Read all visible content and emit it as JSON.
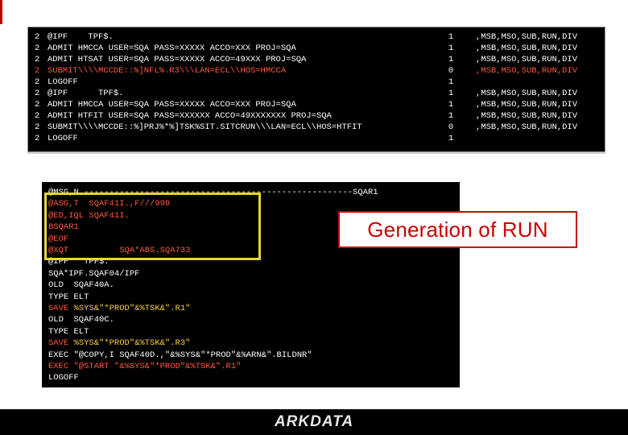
{
  "screen1": {
    "rows": [
      {
        "n": "2",
        "cmd": "@IPF    TPF$.",
        "num": "1",
        "flags": ",MSB,MSO,SUB,RUN,DIV",
        "alert": false
      },
      {
        "n": "2",
        "cmd": "ADMIT HMCCA USER=SQA PASS=XXXXX ACCO=XXX PROJ=SQA",
        "num": "1",
        "flags": ",MSB,MSO,SUB,RUN,DIV",
        "alert": false
      },
      {
        "n": "2",
        "cmd": "ADMIT HTSAT USER=SQA PASS=XXXXX ACCO=49XXX PROJ=SQA",
        "num": "1",
        "flags": ",MSB,MSO,SUB,RUN,DIV",
        "alert": false
      },
      {
        "n": "2",
        "cmd": "SUBMIT\\\\\\\\MCCDE::%]NFL%.R3\\\\\\LAN=ECL\\\\HOS=HMCCA",
        "num": "0",
        "flags": ",MSB,MSO,SUB,RUN,DIV",
        "alert": true
      },
      {
        "n": "2",
        "cmd": "LOGOFF",
        "num": "1",
        "flags": "",
        "alert": false
      },
      {
        "n": "2",
        "cmd": "@IPF      TPF$.",
        "num": "1",
        "flags": ",MSB,MSO,SUB,RUN,DIV",
        "alert": false
      },
      {
        "n": "2",
        "cmd": "ADMIT HMCCA USER=SQA PASS=XXXXX ACCO=XXX PROJ=SQA",
        "num": "1",
        "flags": ",MSB,MSO,SUB,RUN,DIV",
        "alert": false
      },
      {
        "n": "2",
        "cmd": "ADMIT HTFIT USER=SQA PASS=XXXXXX ACCO=49XXXXXXX PROJ=SQA",
        "num": "1",
        "flags": ",MSB,MSO,SUB,RUN,DIV",
        "alert": false
      },
      {
        "n": "2",
        "cmd": "SUBMIT\\\\\\\\MCCDE::%]PRJ%*%]TSK%SIT.SITCRUN\\\\\\LAN=ECL\\\\HOS=HTFIT",
        "num": "0",
        "flags": ",MSB,MSO,SUB,RUN,DIV",
        "alert": false
      },
      {
        "n": "2",
        "cmd": "LOGOFF",
        "num": "1",
        "flags": "",
        "alert": false
      }
    ]
  },
  "screen2": {
    "lines": [
      {
        "text": "@MSG,N -----------------------------------------------------SQAR1",
        "color": "w"
      },
      {
        "text": "@ASG,T  SQAF41I.,F///999",
        "color": "red"
      },
      {
        "text": "@ED,IQL SQAF41I.",
        "color": "red"
      },
      {
        "text": "BSQAR1",
        "color": "red"
      },
      {
        "text": "@EOF",
        "color": "red"
      },
      {
        "text": "@XQT          SQA*ABS.SQA733",
        "color": "red"
      },
      {
        "text": "@IPF   TPF$.",
        "color": "w"
      },
      {
        "text": "SQA*IPF.SQAF04/IPF",
        "color": "w"
      },
      {
        "text": "OLD  SQAF40A.",
        "color": "w"
      },
      {
        "text": "TYPE ELT",
        "color": "w"
      },
      {
        "pre": "SAVE ",
        "yel": "%SYS&\"*PROD\"&%TSK&\".R1\"",
        "color": "red"
      },
      {
        "text": "OLD  SQAF40C.",
        "color": "w"
      },
      {
        "text": "TYPE ELT",
        "color": "w"
      },
      {
        "pre": "SAVE ",
        "yel": "%SYS&\"*PROD\"&%TSK&\".R3\"",
        "color": "red"
      },
      {
        "text": "EXEC \"@COPY,I SQAF40D.,\"&%SYS&\"*PROD\"&%ARN&\".BILDNR\"",
        "color": "w"
      },
      {
        "text": "EXEC \"@START \"&%SYS&\"*PROD\"&%TSK&\".R1\"",
        "color": "red"
      },
      {
        "text": "LOGOFF",
        "color": "w"
      }
    ]
  },
  "banner": "Generation of RUN",
  "footer": {
    "logo": "ARKDATA"
  },
  "colors": {
    "alert": "#ff5a3c",
    "highlight": "#e6d53a",
    "banner": "#cc0000"
  }
}
